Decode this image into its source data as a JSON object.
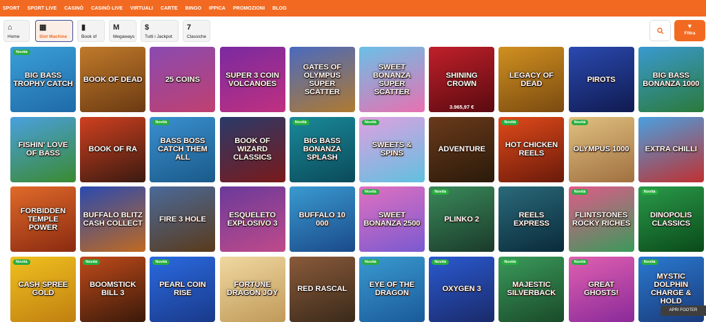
{
  "topnav": [
    "SPORT",
    "SPORT LIVE",
    "CASINÒ",
    "CASINÒ LIVE",
    "VIRTUALI",
    "CARTE",
    "BINGO",
    "IPPICA",
    "PROMOZIONI",
    "BLOG"
  ],
  "categories": [
    {
      "label": "Home",
      "icon": "⌂",
      "icon_name": "home-icon"
    },
    {
      "label": "Slot Machine",
      "icon": "▦",
      "icon_name": "slot-machine-icon",
      "active": true
    },
    {
      "label": "Book of",
      "icon": "▮",
      "icon_name": "book-icon"
    },
    {
      "label": "Megaways",
      "icon": "M",
      "icon_name": "megaways-icon"
    },
    {
      "label": "Tutti i Jackpot",
      "icon": "$",
      "icon_name": "jackpot-bag-icon"
    },
    {
      "label": "Classiche",
      "icon": "7",
      "icon_name": "seven-icon"
    }
  ],
  "search_icon": "search-icon",
  "filter": {
    "label": "Filtra",
    "icon": "▼",
    "icon_name": "funnel-icon"
  },
  "badge_label": "Novità",
  "games": [
    {
      "name": "Big Bass Trophy Catch",
      "colors": [
        "#3aa0d8",
        "#1f6aa8"
      ],
      "new": true
    },
    {
      "name": "Book of Dead",
      "colors": [
        "#c07a2a",
        "#6b3a12"
      ]
    },
    {
      "name": "25 Coins",
      "colors": [
        "#8a4ab0",
        "#c04070"
      ]
    },
    {
      "name": "Super 3 Coin Volcanoes",
      "colors": [
        "#7a2aa0",
        "#c03080"
      ]
    },
    {
      "name": "Gates of Olympus Super Scatter",
      "colors": [
        "#4a6ac0",
        "#b07a30"
      ]
    },
    {
      "name": "Sweet Bonanza Super Scatter",
      "colors": [
        "#6ac0e8",
        "#e870b0"
      ]
    },
    {
      "name": "Shining Crown",
      "colors": [
        "#c0202a",
        "#5a0a10"
      ],
      "jackpot": "3.965,97 €"
    },
    {
      "name": "Legacy of Dead",
      "colors": [
        "#d09020",
        "#7a4a10"
      ]
    },
    {
      "name": "Pirots",
      "colors": [
        "#2a4ab0",
        "#101a50"
      ]
    },
    {
      "name": "Big Bass Bonanza 1000",
      "colors": [
        "#3a9ad0",
        "#2a7a3a"
      ]
    },
    {
      "name": "Fishin' Love of Bass",
      "colors": [
        "#4aa0e0",
        "#3a8a30"
      ]
    },
    {
      "name": "Book of Ra",
      "colors": [
        "#d04020",
        "#3a1a10"
      ]
    },
    {
      "name": "Bass Boss Catch Them All",
      "colors": [
        "#3a90d0",
        "#1a5a8a"
      ],
      "new": true
    },
    {
      "name": "Book of Wizard Classics",
      "colors": [
        "#2a3a6a",
        "#7a1a1a"
      ]
    },
    {
      "name": "Big Bass Bonanza Splash",
      "colors": [
        "#1a8a9a",
        "#0a4a5a"
      ],
      "new": true
    },
    {
      "name": "Sweets & Spins",
      "colors": [
        "#e0a0e0",
        "#60c0e0"
      ],
      "new": true
    },
    {
      "name": "Adventure",
      "colors": [
        "#6a3a1a",
        "#2a1a0a"
      ]
    },
    {
      "name": "Hot Chicken Reels",
      "colors": [
        "#e04a1a",
        "#6a1a0a"
      ],
      "new": true
    },
    {
      "name": "Olympus 1000",
      "colors": [
        "#e0c080",
        "#a07040"
      ],
      "new": true
    },
    {
      "name": "Extra Chilli",
      "colors": [
        "#4aa0e0",
        "#c03030"
      ]
    },
    {
      "name": "Forbidden Temple Power",
      "colors": [
        "#e06a2a",
        "#8a2a10"
      ]
    },
    {
      "name": "Buffalo Blitz Cash Collect",
      "colors": [
        "#2a4ab0",
        "#c06a20"
      ]
    },
    {
      "name": "Fire 3 Hole",
      "colors": [
        "#4a6a9a",
        "#5a3a1a"
      ]
    },
    {
      "name": "Esqueleto Explosivo 3",
      "colors": [
        "#6a3a9a",
        "#c04a8a"
      ]
    },
    {
      "name": "Buffalo 10 000",
      "colors": [
        "#3a9ad0",
        "#1a4a8a"
      ]
    },
    {
      "name": "Sweet Bonanza 2500",
      "colors": [
        "#e070c0",
        "#7a5ad0"
      ],
      "new": true
    },
    {
      "name": "Plinko 2",
      "colors": [
        "#3a8a5a",
        "#1a3a2a"
      ],
      "new": true
    },
    {
      "name": "Reels Express",
      "colors": [
        "#2a6a7a",
        "#0a2a3a"
      ]
    },
    {
      "name": "Flintstones Rocky Riches",
      "colors": [
        "#e05a8a",
        "#3a9a5a"
      ],
      "new": true
    },
    {
      "name": "Dinopolis Classics",
      "colors": [
        "#2a9a4a",
        "#0a4a1a"
      ],
      "new": true
    },
    {
      "name": "Cash Spree Gold",
      "colors": [
        "#f0c020",
        "#c08010"
      ],
      "new": true
    },
    {
      "name": "Boomstick Bill 3",
      "colors": [
        "#c04a1a",
        "#3a1a0a"
      ],
      "new": true
    },
    {
      "name": "Pearl Coin Rise",
      "colors": [
        "#2a6ae0",
        "#1a3a8a"
      ],
      "new": true
    },
    {
      "name": "Fortune Dragon Joy",
      "colors": [
        "#f0d8a0",
        "#c09a5a"
      ]
    },
    {
      "name": "Red Rascal",
      "colors": [
        "#8a5a3a",
        "#3a2a1a"
      ]
    },
    {
      "name": "Eye of the Dragon",
      "colors": [
        "#3a9ad0",
        "#1a5a9a"
      ],
      "new": true
    },
    {
      "name": "Oxygen 3",
      "colors": [
        "#2a5ad0",
        "#1a2a6a"
      ],
      "new": true
    },
    {
      "name": "Majestic Silverback",
      "colors": [
        "#3a9a5a",
        "#1a4a2a"
      ],
      "new": true
    },
    {
      "name": "Great Ghosts!",
      "colors": [
        "#e060b0",
        "#8a2a9a"
      ],
      "new": true
    },
    {
      "name": "Mystic Dolphin Charge & Hold",
      "colors": [
        "#2a7ad0",
        "#1a3a7a"
      ],
      "new": true
    }
  ],
  "footer_button": "APRI FOOTER",
  "colors": {
    "brand": "#f26a21",
    "badge": "#27ae3e"
  }
}
